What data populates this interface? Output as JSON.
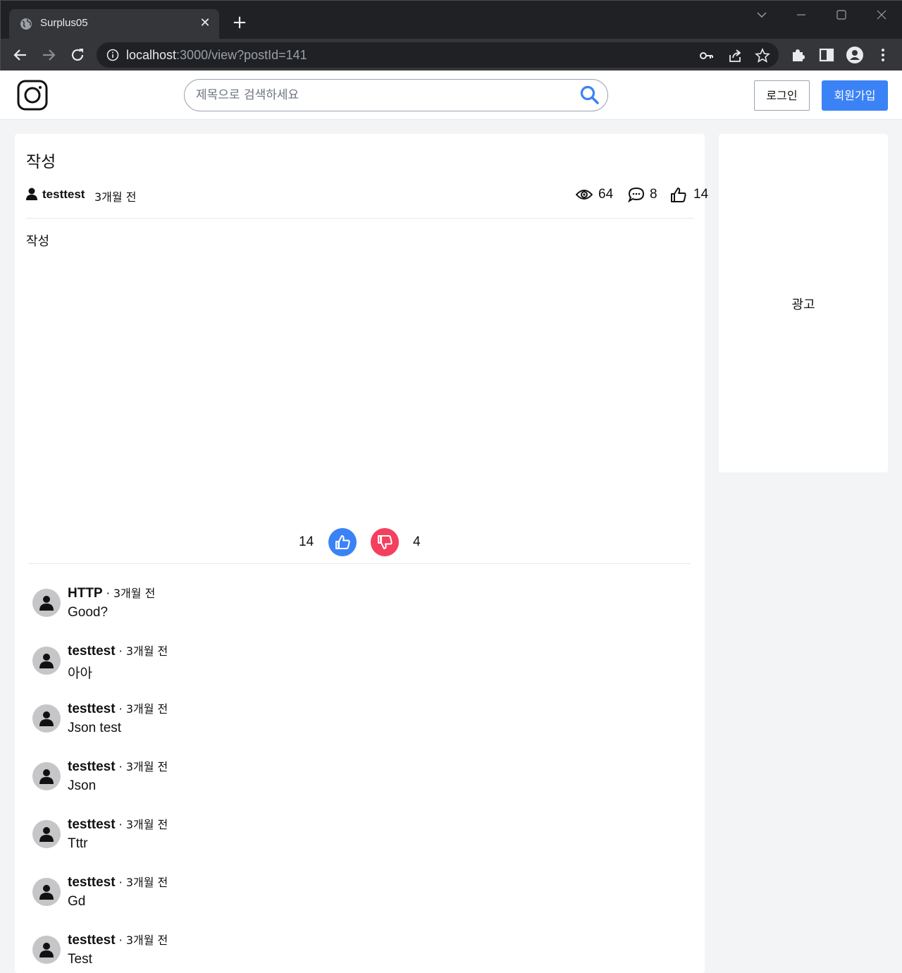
{
  "browser": {
    "tab_title": "Surplus05",
    "url_host": "localhost",
    "url_rest": ":3000/view?postId=141"
  },
  "header": {
    "search_placeholder": "제목으로 검색하세요",
    "login_label": "로그인",
    "signup_label": "회원가입",
    "accent_color": "#3b82f6"
  },
  "post": {
    "title": "작성",
    "author": "testtest",
    "time": "3개월 전",
    "views": "64",
    "comments_count": "8",
    "likes": "14",
    "body": "작성",
    "vote_up": "14",
    "vote_down": "4",
    "dislike_color": "#f43f5e"
  },
  "comments": [
    {
      "author": "HTTP",
      "sep": " · ",
      "time": "3개월 전",
      "text": "Good?"
    },
    {
      "author": "testtest",
      "sep": " · ",
      "time": "3개월 전",
      "text": "아아"
    },
    {
      "author": "testtest",
      "sep": " · ",
      "time": "3개월 전",
      "text": "Json test"
    },
    {
      "author": "testtest",
      "sep": " · ",
      "time": "3개월 전",
      "text": "Json"
    },
    {
      "author": "testtest",
      "sep": " · ",
      "time": "3개월 전",
      "text": "Tttr"
    },
    {
      "author": "testtest",
      "sep": " · ",
      "time": "3개월 전",
      "text": "Gd"
    },
    {
      "author": "testtest",
      "sep": " · ",
      "time": "3개월 전",
      "text": "Test"
    }
  ],
  "ad": {
    "label": "광고"
  }
}
